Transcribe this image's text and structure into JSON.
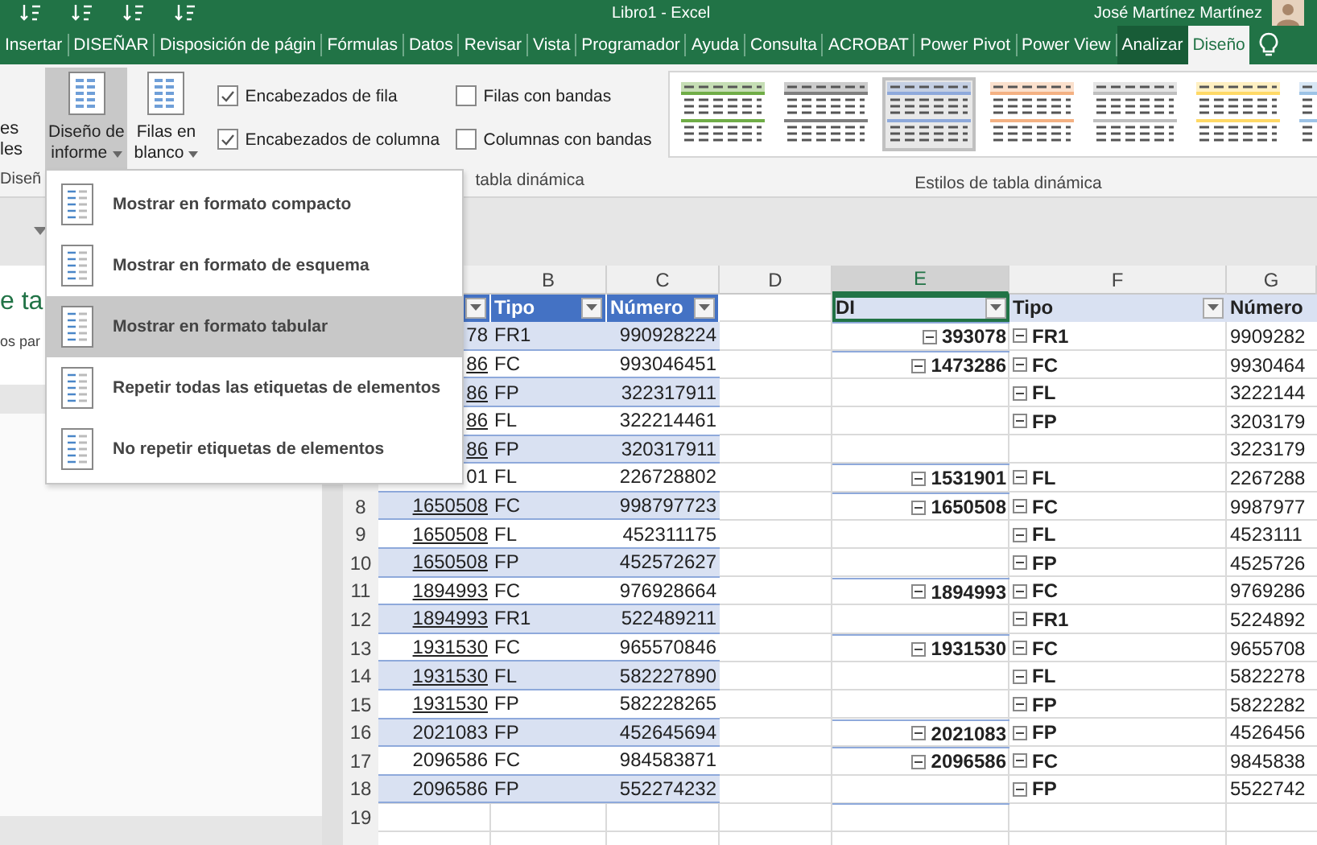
{
  "title_bar": {
    "document": "Libro1 - Excel",
    "user": "José Martínez Martínez"
  },
  "tabs": [
    {
      "label": "Insertar",
      "selected": false,
      "contextual": false
    },
    {
      "label": "DISEÑAR",
      "selected": false,
      "contextual": false
    },
    {
      "label": "Disposición de págin",
      "selected": false,
      "contextual": false
    },
    {
      "label": "Fórmulas",
      "selected": false,
      "contextual": false
    },
    {
      "label": "Datos",
      "selected": false,
      "contextual": false
    },
    {
      "label": "Revisar",
      "selected": false,
      "contextual": false
    },
    {
      "label": "Vista",
      "selected": false,
      "contextual": false
    },
    {
      "label": "Programador",
      "selected": false,
      "contextual": false
    },
    {
      "label": "Ayuda",
      "selected": false,
      "contextual": false
    },
    {
      "label": "Consulta",
      "selected": false,
      "contextual": false
    },
    {
      "label": "ACROBAT",
      "selected": false,
      "contextual": false
    },
    {
      "label": "Power Pivot",
      "selected": false,
      "contextual": false
    },
    {
      "label": "Power View",
      "selected": false,
      "contextual": false
    },
    {
      "label": "Analizar",
      "selected": false,
      "contextual": true
    },
    {
      "label": "Diseño",
      "selected": true,
      "contextual": true
    }
  ],
  "ribbon": {
    "partial_button": [
      "es",
      "les"
    ],
    "partial_group_label": "Diseñ",
    "layout_buttons": [
      {
        "line1": "Diseño de",
        "line2": "informe",
        "pressed": true
      },
      {
        "line1": "Filas en",
        "line2": "blanco",
        "pressed": false
      }
    ],
    "options": [
      {
        "label": "Encabezados de fila",
        "checked": true
      },
      {
        "label": "Encabezados de columna",
        "checked": true
      },
      {
        "label": "Filas con bandas",
        "checked": false
      },
      {
        "label": "Columnas con bandas",
        "checked": false
      }
    ],
    "options_group_label": "tabla dinámica",
    "styles": [
      {
        "color": "#70ad47",
        "selected": false
      },
      {
        "color": "#7f7f7f",
        "selected": false
      },
      {
        "color": "#8ea9db",
        "selected": true
      },
      {
        "color": "#f4b183",
        "selected": false
      },
      {
        "color": "#bfbfbf",
        "selected": false
      },
      {
        "color": "#ffd966",
        "selected": false
      },
      {
        "color": "#9dc3e6",
        "selected": false
      }
    ],
    "styles_group_label": "Estilos de tabla dinámica"
  },
  "task_pane": {
    "title": "e ta",
    "subtitle": "os par"
  },
  "sheet": {
    "columns": [
      {
        "letter": "B",
        "selected": false
      },
      {
        "letter": "C",
        "selected": false
      },
      {
        "letter": "D",
        "selected": false
      },
      {
        "letter": "E",
        "selected": true
      },
      {
        "letter": "F",
        "selected": false
      },
      {
        "letter": "G",
        "selected": false
      }
    ],
    "header": {
      "b": "Tipo",
      "c": "Número",
      "di": "DI",
      "tipo": "Tipo",
      "numero": "Número"
    },
    "rows": [
      {
        "a": "78",
        "link": false,
        "b": "FR1",
        "c": "990928224",
        "di": "393078",
        "tipo": "FR1",
        "numero": "9909282"
      },
      {
        "a": "86",
        "link": true,
        "b": "FC",
        "c": "993046451",
        "di": "1473286",
        "tipo": "FC",
        "numero": "9930464"
      },
      {
        "a": "86",
        "link": true,
        "b": "FP",
        "c": "322317911",
        "tipo": "FL",
        "numero": "3222144"
      },
      {
        "a": "86",
        "link": true,
        "b": "FL",
        "c": "322214461",
        "tipo": "FP",
        "numero": "3203179"
      },
      {
        "a": "86",
        "link": true,
        "b": "FP",
        "c": "320317911",
        "numero": "3223179"
      },
      {
        "a": "01",
        "link": false,
        "b": "FL",
        "c": "226728802",
        "di": "1531901",
        "tipo": "FL",
        "numero": "2267288"
      },
      {
        "row": "8",
        "a": "1650508",
        "link": true,
        "b": "FC",
        "c": "998797723",
        "di": "1650508",
        "tipo": "FC",
        "numero": "9987977"
      },
      {
        "row": "9",
        "a": "1650508",
        "link": true,
        "b": "FL",
        "c": "452311175",
        "tipo": "FL",
        "numero": "4523111"
      },
      {
        "row": "10",
        "a": "1650508",
        "link": true,
        "b": "FP",
        "c": "452572627",
        "tipo": "FP",
        "numero": "4525726"
      },
      {
        "row": "11",
        "a": "1894993",
        "link": true,
        "b": "FC",
        "c": "976928664",
        "di": "1894993",
        "tipo": "FC",
        "numero": "9769286"
      },
      {
        "row": "12",
        "a": "1894993",
        "link": true,
        "b": "FR1",
        "c": "522489211",
        "tipo": "FR1",
        "numero": "5224892"
      },
      {
        "row": "13",
        "a": "1931530",
        "link": true,
        "b": "FC",
        "c": "965570846",
        "di": "1931530",
        "tipo": "FC",
        "numero": "9655708"
      },
      {
        "row": "14",
        "a": "1931530",
        "link": true,
        "b": "FL",
        "c": "582227890",
        "tipo": "FL",
        "numero": "5822278"
      },
      {
        "row": "15",
        "a": "1931530",
        "link": true,
        "b": "FP",
        "c": "582228265",
        "tipo": "FP",
        "numero": "5822282"
      },
      {
        "row": "16",
        "a": "2021083",
        "link": false,
        "b": "FP",
        "c": "452645694",
        "di": "2021083",
        "tipo": "FP",
        "numero": "4526456"
      },
      {
        "row": "17",
        "a": "2096586",
        "link": false,
        "b": "FC",
        "c": "984583871",
        "di": "2096586",
        "tipo": "FC",
        "numero": "9845838"
      },
      {
        "row": "18",
        "a": "2096586",
        "link": false,
        "b": "FP",
        "c": "552274232",
        "tipo": "FP",
        "numero": "5522742"
      }
    ],
    "empty_rows": [
      "19"
    ]
  },
  "menu": {
    "items": [
      {
        "label": "Mostrar en formato compacto",
        "selected": false
      },
      {
        "label": "Mostrar en formato de esquema",
        "selected": false
      },
      {
        "label": "Mostrar en formato tabular",
        "selected": true
      },
      {
        "label": "Repetir todas las etiquetas de elementos",
        "selected": false
      },
      {
        "label": "No repetir etiquetas de elementos",
        "selected": false
      }
    ]
  }
}
